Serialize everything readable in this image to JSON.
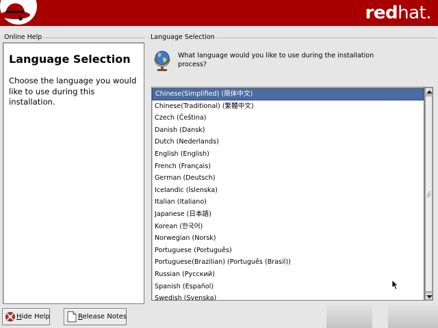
{
  "header": {
    "brand_bold": "red",
    "brand_light": "hat.",
    "brand_color": "#a80000"
  },
  "help_panel": {
    "frame_label": "Online Help",
    "title": "Language Selection",
    "body": "Choose the language you would like to use during this installation."
  },
  "main": {
    "frame_label": "Language Selection",
    "question": "What language would you like to use during the installation process?",
    "icon": "globe-icon",
    "selected_index": 0,
    "languages": [
      "Chinese(Simplified) (简体中文)",
      "Chinese(Traditional) (繁體中文)",
      "Czech (Čeština)",
      "Danish (Dansk)",
      "Dutch (Nederlands)",
      "English (English)",
      "French (Français)",
      "German (Deutsch)",
      "Icelandic (Íslenska)",
      "Italian (Italiano)",
      "Japanese (日本語)",
      "Korean (한국어)",
      "Norwegian (Norsk)",
      "Portuguese (Português)",
      "Portuguese(Brazilian) (Português (Brasil))",
      "Russian (Русский)",
      "Spanish (Español)",
      "Swedish (Svenska)"
    ]
  },
  "buttons": {
    "hide_help_prefix": "H",
    "hide_help_rest": "ide Help",
    "release_notes_prefix": "R",
    "release_notes_rest": "elease Notes"
  },
  "colors": {
    "selection": "#4b6ba3",
    "window_bg": "#e6e6e6"
  }
}
